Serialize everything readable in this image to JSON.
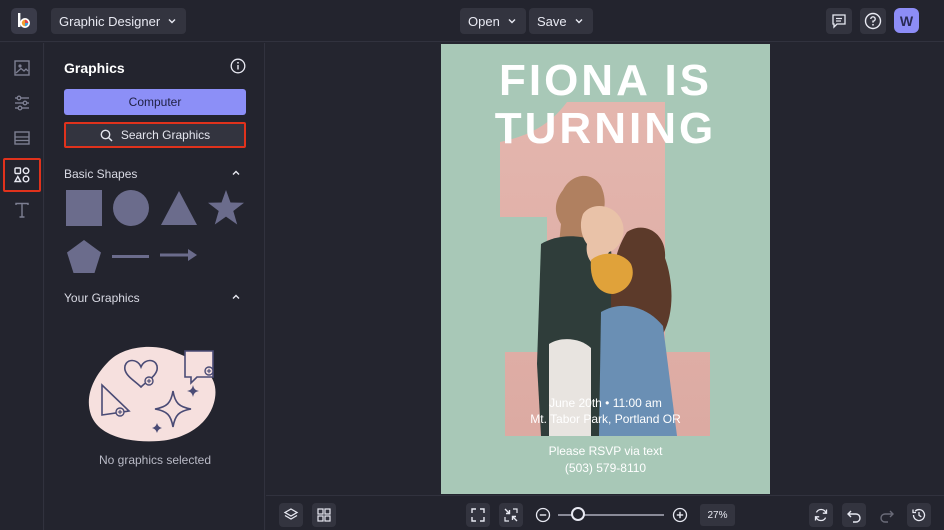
{
  "topbar": {
    "app_name": "Graphic Designer",
    "open_label": "Open",
    "save_label": "Save",
    "avatar_initial": "W"
  },
  "rail": {
    "items": [
      "image-icon",
      "sliders-icon",
      "layout-icon",
      "graphics-icon",
      "text-icon"
    ],
    "active_index": 3
  },
  "panel": {
    "title": "Graphics",
    "computer_label": "Computer",
    "search_label": "Search Graphics",
    "basic_shapes_label": "Basic Shapes",
    "your_graphics_label": "Your Graphics",
    "empty_text": "No graphics selected"
  },
  "poster": {
    "title_line1": "FIONA IS",
    "title_line2": "TURNING",
    "date": "June 20th • 11:00 am",
    "location": "Mt. Tabor Park, Portland OR",
    "rsvp": "Please RSVP via text",
    "phone": "(503) 579-8110",
    "background_color": "#a8c8b7",
    "numeral_color": "#e8b8b0"
  },
  "bottombar": {
    "zoom": "27%",
    "zoom_fraction": 0.27
  },
  "colors": {
    "accent": "#8c8ff7",
    "highlight": "#e0321c",
    "panel_bg": "#23242e"
  }
}
